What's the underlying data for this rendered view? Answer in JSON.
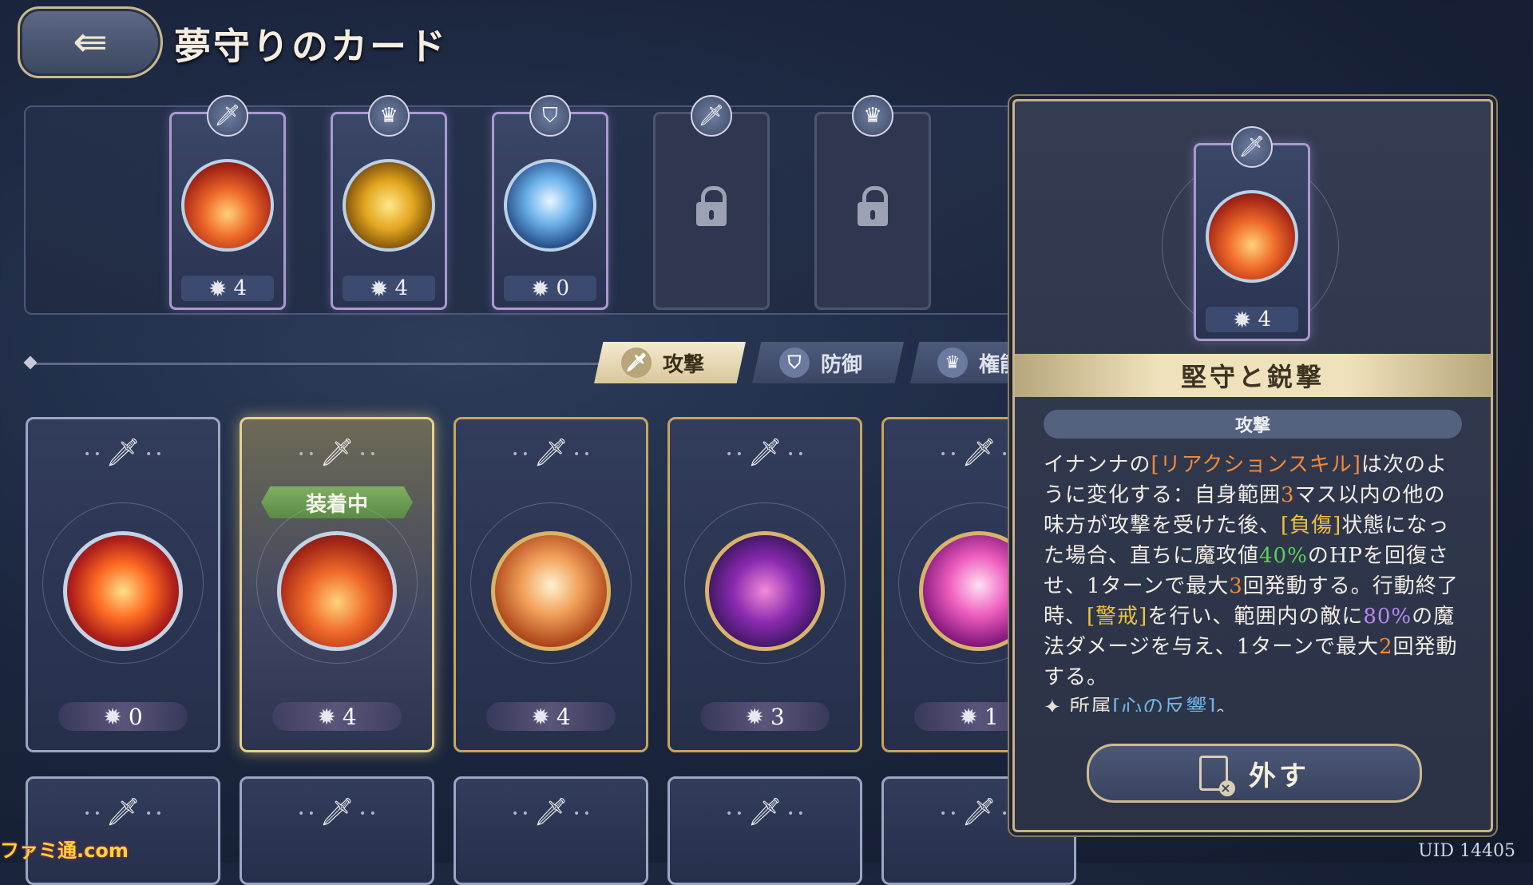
{
  "header": {
    "back_icon": "back-arrow-icon",
    "title": "夢守りのカード"
  },
  "slots": [
    {
      "type_icon": "sword-icon",
      "type_glyph": "🗡",
      "art": "fire-flower",
      "cost": "4",
      "locked": false
    },
    {
      "type_icon": "crown-icon",
      "type_glyph": "♛",
      "art": "gold-sword",
      "cost": "4",
      "locked": false
    },
    {
      "type_icon": "shield-icon",
      "type_glyph": "⛉",
      "art": "ice-spikes",
      "cost": "0",
      "locked": false
    },
    {
      "type_icon": "sword-icon",
      "type_glyph": "🗡",
      "locked": true
    },
    {
      "type_icon": "crown-icon",
      "type_glyph": "♛",
      "locked": true
    }
  ],
  "tabs": [
    {
      "label": "攻撃",
      "icon": "sword-icon",
      "glyph": "🗡",
      "active": true
    },
    {
      "label": "防御",
      "icon": "shield-icon",
      "glyph": "⛉",
      "active": false
    },
    {
      "label": "権能",
      "icon": "crown-icon",
      "glyph": "♛",
      "active": false
    }
  ],
  "cards": [
    {
      "art": "flame",
      "cost": "0",
      "equipped": false
    },
    {
      "art": "fire-flower",
      "cost": "4",
      "equipped": true,
      "badge": "装着中"
    },
    {
      "art": "swirl",
      "cost": "4",
      "equipped": false
    },
    {
      "art": "dark-shield",
      "cost": "3",
      "equipped": false
    },
    {
      "art": "pink-burst",
      "cost": "1",
      "equipped": false
    }
  ],
  "detail": {
    "type_icon": "sword-icon",
    "cost": "4",
    "name": "堅守と鋭撃",
    "type_label": "攻撃",
    "description_parts": [
      {
        "t": "イナンナの",
        "c": ""
      },
      {
        "t": "[リアクションスキル]",
        "c": "orange"
      },
      {
        "t": "は次のように変化する：自身範囲",
        "c": ""
      },
      {
        "t": "3",
        "c": "orange"
      },
      {
        "t": "マス以内の他の味方が攻撃を受けた後、",
        "c": ""
      },
      {
        "t": "[負傷]",
        "c": "yellow"
      },
      {
        "t": "状態になった場合、直ちに魔攻値",
        "c": ""
      },
      {
        "t": "40%",
        "c": "green"
      },
      {
        "t": "のHPを回復させ、1ターンで最大",
        "c": ""
      },
      {
        "t": "3",
        "c": "orange"
      },
      {
        "t": "回発動する。行動終了時、",
        "c": ""
      },
      {
        "t": "[警戒]",
        "c": "yellow"
      },
      {
        "t": "を行い、範囲内の敵に",
        "c": ""
      },
      {
        "t": "80%",
        "c": "purple"
      },
      {
        "t": "の魔法ダメージを与え、1ターンで最大",
        "c": ""
      },
      {
        "t": "2",
        "c": "orange"
      },
      {
        "t": "回発動する。",
        "c": ""
      }
    ],
    "affiliation_prefix": "✦ 所属",
    "affiliation_value": "[心の反響]",
    "affiliation_suffix": "。",
    "remove_label": "外す"
  },
  "footer": {
    "uid": "UID 14405",
    "watermark": "ファミ通.com"
  },
  "colors": {
    "orange": "#f08a3c",
    "yellow": "#f2c23a",
    "green": "#5bd05a",
    "purple": "#b988f0",
    "blue": "#6fb5e8",
    "gold_border": "#c7b386"
  }
}
